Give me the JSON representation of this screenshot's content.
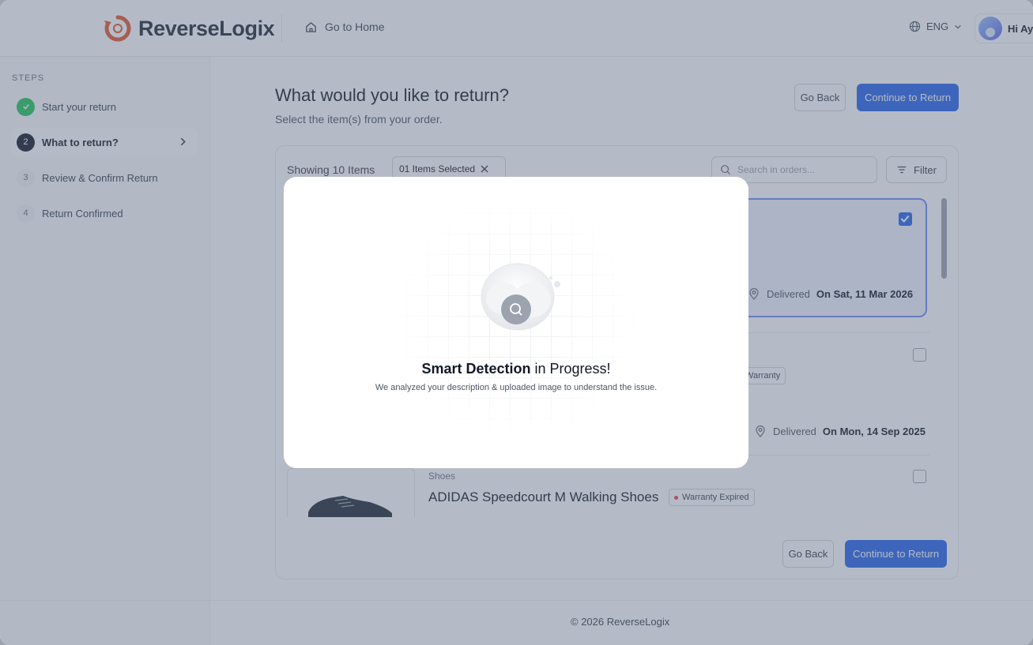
{
  "header": {
    "brand": "ReverseLogix",
    "home_link": "Go to Home",
    "language": "ENG",
    "user_greeting": "Hi Ayu"
  },
  "sidebar": {
    "section_label": "STEPS",
    "steps": [
      {
        "number": "1",
        "label": "Start your return",
        "state": "done"
      },
      {
        "number": "2",
        "label": "What to return?",
        "state": "current"
      },
      {
        "number": "3",
        "label": "Review & Confirm Return",
        "state": "pending"
      },
      {
        "number": "4",
        "label": "Return Confirmed",
        "state": "pending"
      }
    ]
  },
  "main": {
    "title": "What would you like to return?",
    "subtitle": "Select the item(s) from your order.",
    "go_back_label": "Go Back",
    "continue_label": "Continue to Return",
    "showing_text": "Showing 10 Items",
    "selected_chip": "01 Items Selected",
    "search_placeholder": "Search in orders...",
    "filter_label": "Filter"
  },
  "items": [
    {
      "delivered_label": "Delivered",
      "delivered_date": "On Sat, 11 Mar 2026",
      "selected": true
    },
    {
      "badge": "Warranty",
      "delivered_label": "Delivered",
      "delivered_date": "On Mon, 14 Sep 2025",
      "selected": false
    },
    {
      "category": "Shoes",
      "name": "ADIDAS Speedcourt M Walking Shoes",
      "badge": "Warranty Expired",
      "selected": false
    }
  ],
  "footer": {
    "copyright": "© 2026 ReverseLogix"
  },
  "modal": {
    "title_bold": "Smart Detection",
    "title_rest": " in Progress!",
    "description": "We analyzed your description & uploaded image to understand the issue."
  },
  "colors": {
    "primary": "#2563eb",
    "brand_orange": "#e4572e",
    "success": "#22c55e",
    "overlay": "#5a6880"
  }
}
